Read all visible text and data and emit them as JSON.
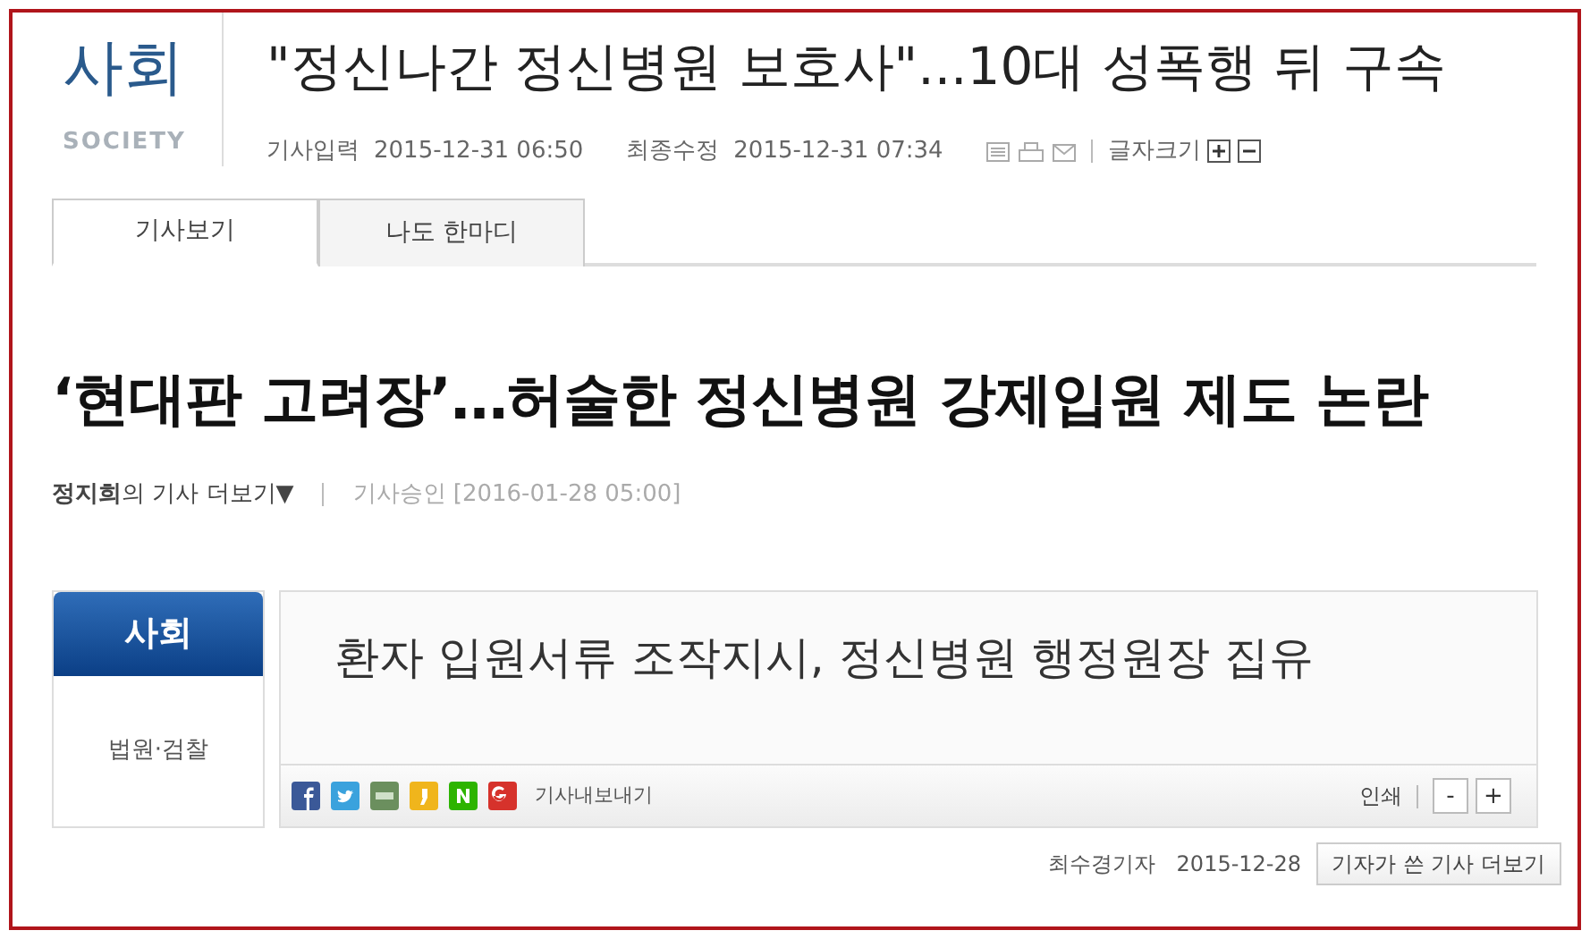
{
  "section": {
    "label": "사회",
    "english": "SOCIETY"
  },
  "headline": "\"정신나간 정신병원 보호사\"...10대 성폭행 뒤 구속",
  "meta": {
    "input_label": "기사입력",
    "input_time": "2015-12-31 06:50",
    "modified_label": "최종수정",
    "modified_time": "2015-12-31 07:34",
    "font_size_label": "글자크기"
  },
  "tabs": [
    {
      "label": "기사보기",
      "selected": true
    },
    {
      "label": "나도 한마디",
      "selected": false
    }
  ],
  "article_title": "‘현대판 고려장’…허술한 정신병원 강제입원 제도 논란",
  "byline": {
    "author_line": "**정지희**의 기사 더보기▼",
    "approved": "기사승인 [2016-01-28 05:00]"
  },
  "box": {
    "category": "사회",
    "subcategory": "법원·검찰",
    "headline": "환자 입원서류 조작지시, 정신병원 행정원장 집유",
    "share_label": "기사내보내기",
    "print_label": "인쇄",
    "minus": "-",
    "plus": "+"
  },
  "footer": {
    "reporter": "최수경기자",
    "date": "2015-12-28",
    "button": "기자가 쓴 기사 더보기"
  }
}
